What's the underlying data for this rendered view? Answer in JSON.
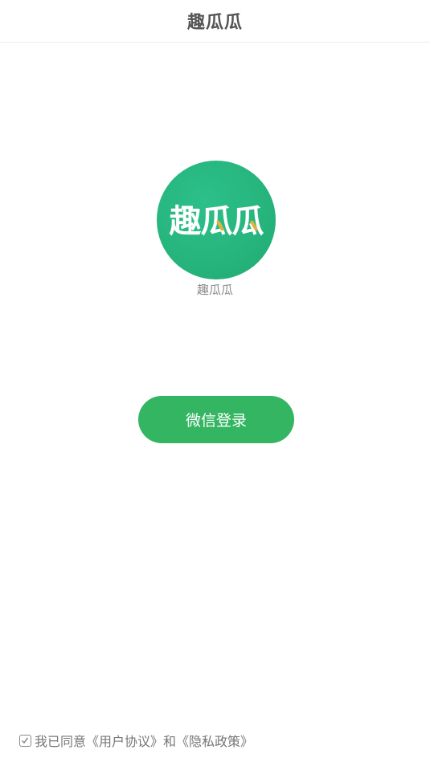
{
  "navbar": {
    "title": "趣瓜瓜"
  },
  "logo": {
    "text": "趣瓜瓜",
    "bg_color": "#26b47c",
    "mark_color": "#e2b33c"
  },
  "app_name": "趣瓜瓜",
  "login_button": {
    "label": "微信登录",
    "color": "#33b562"
  },
  "agreement": {
    "checked": true,
    "prefix": "我已同意",
    "user_agreement": "《用户协议》",
    "conjunction": "和",
    "privacy_policy": "《隐私政策》"
  }
}
